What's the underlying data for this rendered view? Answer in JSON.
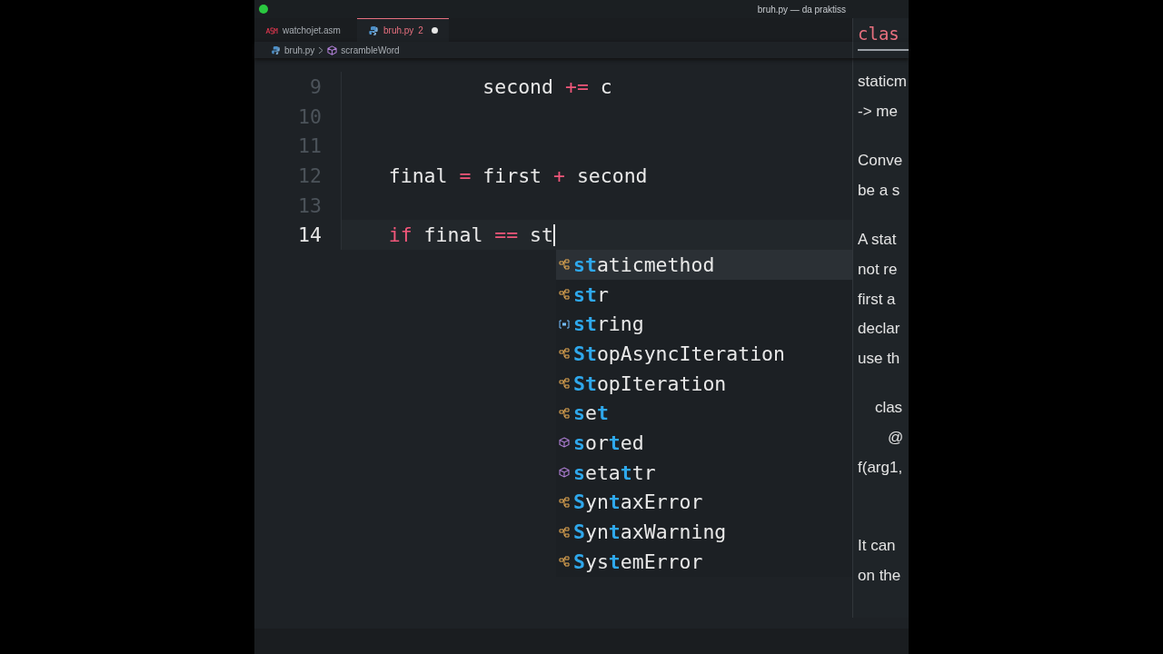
{
  "window": {
    "title": "bruh.py — da praktiss"
  },
  "tabs": [
    {
      "label": "watchojet.asm",
      "kind": "asm",
      "selected": false,
      "modified": false
    },
    {
      "label": "bruh.py",
      "kind": "python",
      "selected": true,
      "modified": true,
      "problems": "2"
    }
  ],
  "breadcrumb": {
    "file": "bruh.py",
    "symbol": "scrambleWord"
  },
  "editor": {
    "lines": [
      {
        "number": "9",
        "current": false,
        "tokens": [
          {
            "text": "        second ",
            "kind": "name"
          },
          {
            "text": "+=",
            "kind": "operator"
          },
          {
            "text": " c",
            "kind": "name"
          }
        ]
      },
      {
        "number": "10",
        "current": false
      },
      {
        "number": "11",
        "current": false
      },
      {
        "number": "12",
        "current": false,
        "tokens": [
          {
            "text": "final ",
            "kind": "name"
          },
          {
            "text": "=",
            "kind": "operator"
          },
          {
            "text": " first ",
            "kind": "name"
          },
          {
            "text": "+",
            "kind": "operator"
          },
          {
            "text": " second",
            "kind": "name"
          }
        ]
      },
      {
        "number": "13",
        "current": false
      },
      {
        "number": "14",
        "current": true,
        "tokens": [
          {
            "text": "if",
            "kind": "keyword"
          },
          {
            "text": " final ",
            "kind": "name"
          },
          {
            "text": "==",
            "kind": "operator"
          },
          {
            "text": " st",
            "kind": "name"
          }
        ]
      }
    ]
  },
  "suggestions": [
    {
      "label": "**st**aticmethod",
      "kind": "class",
      "selected": true
    },
    {
      "label": "**st**r",
      "kind": "class",
      "selected": false
    },
    {
      "label": "**st**ring",
      "kind": "variable",
      "selected": false
    },
    {
      "label": "**St**opAsyncIteration",
      "kind": "class",
      "selected": false
    },
    {
      "label": "**St**opIteration",
      "kind": "class",
      "selected": false
    },
    {
      "label": "**s**e**t**",
      "kind": "class",
      "selected": false
    },
    {
      "label": "**s**or**t**ed",
      "kind": "function",
      "selected": false
    },
    {
      "label": "**s**eta**t**tr",
      "kind": "function",
      "selected": false
    },
    {
      "label": "**S**yn**t**axError",
      "kind": "class",
      "selected": false
    },
    {
      "label": "**S**yn**t**axWarning",
      "kind": "class",
      "selected": false
    },
    {
      "label": "**S**ys**t**emError",
      "kind": "class",
      "selected": false
    }
  ],
  "docs": {
    "signature": "clas",
    "paragraphs": [
      {
        "kind": "text",
        "lines": [
          "staticm",
          "-> me"
        ]
      },
      {
        "kind": "text",
        "lines": [
          "Conve",
          "be a s"
        ]
      },
      {
        "kind": "text",
        "lines": [
          "A stat",
          "not re",
          "first a",
          "declar",
          "use th"
        ]
      },
      {
        "kind": "code",
        "lines": [
          "    clas",
          "       @",
          "f(arg1,"
        ]
      },
      {
        "kind": "text",
        "lines": [
          "It can",
          "on the"
        ]
      }
    ]
  }
}
